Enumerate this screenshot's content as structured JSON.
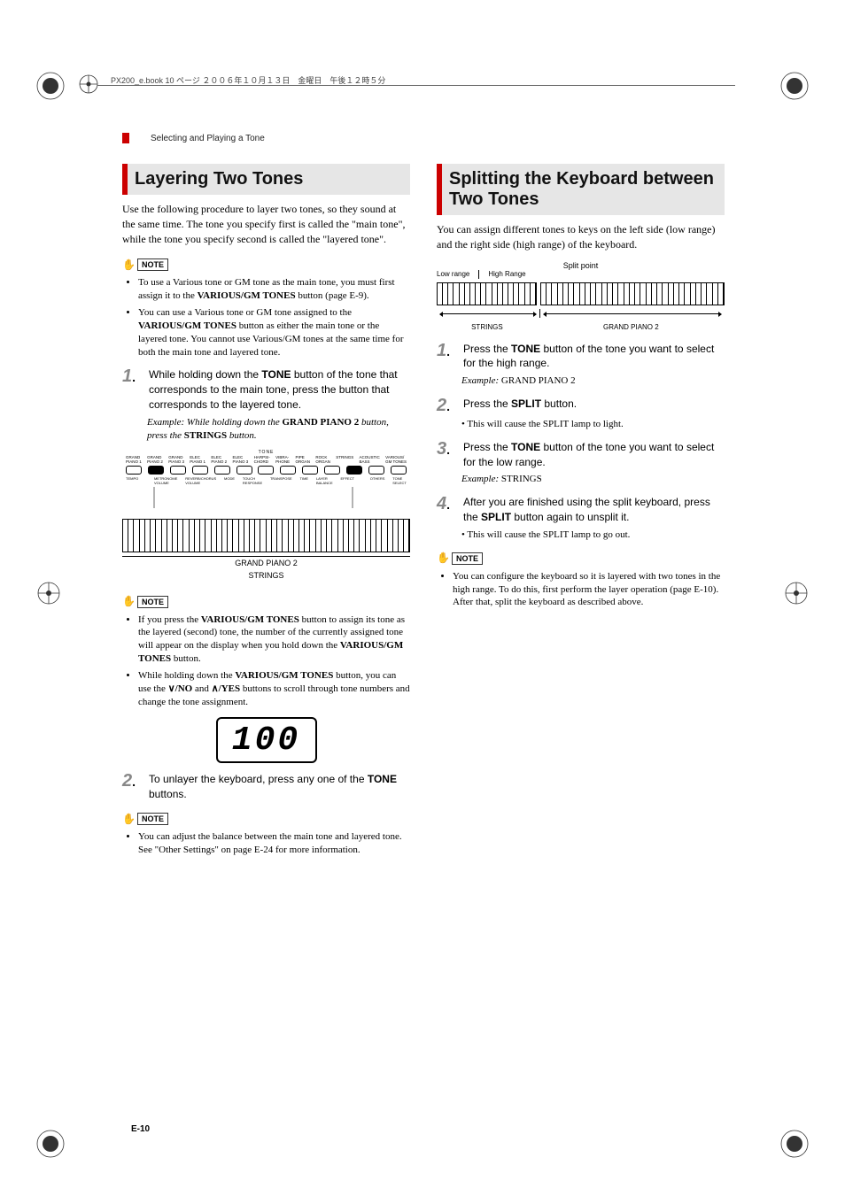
{
  "header_text": "PX200_e.book  10 ページ  ２００６年１０月１３日　金曜日　午後１２時５分",
  "breadcrumb": "Selecting and Playing a Tone",
  "footer_page": "E-10",
  "left": {
    "h2": "Layering Two Tones",
    "intro": "Use the following procedure to layer two tones, so they sound at the same time. The tone you specify first is called the \"main tone\", while the tone you specify second is called the \"layered tone\".",
    "note1_label": "NOTE",
    "note1": [
      "To use a Various tone or GM tone as the main tone, you must first assign it to the VARIOUS/GM TONES button (page E-9).",
      "You can use a Various tone or GM tone assigned to the VARIOUS/GM TONES button as either the main tone or the layered tone. You cannot use Various/GM tones at the same time for both the main tone and layered tone."
    ],
    "step1": "While holding down the TONE button of the tone that corresponds to the main tone, press the button that corresponds to the layered tone.",
    "example1_prefix": "Example:",
    "example1": "While holding down the GRAND PIANO 2 button, press the STRINGS button.",
    "panel": {
      "title": "TONE",
      "top": [
        "GRAND PIANO 1",
        "GRAND PIANO 2",
        "GRAND PIANO 3",
        "ELEC PIANO 1",
        "ELEC PIANO 2",
        "ELEC PIANO 3",
        "HARPSI-CHORD",
        "VIBRA-PHONE",
        "PIPE ORGAN",
        "ROCK ORGAN",
        "STRINGS",
        "ACOUSTIC BASS",
        "VARIOUS/GM TONES"
      ],
      "bot": [
        "TEMPO",
        "",
        "METRONOME VOLUME",
        "REVERB/CHORUS VOLUME",
        "MODE",
        "TOUCH RESPONSE",
        "TRANSPOSE",
        "TIME",
        "LAYER BALANCE",
        "EFFECT",
        "",
        "OTHERS",
        "TONE SELECT"
      ]
    },
    "kbd_caption1": "GRAND PIANO 2",
    "kbd_caption2": "STRINGS",
    "note2_label": "NOTE",
    "note2": [
      "If you press the VARIOUS/GM TONES button to assign its tone as the layered (second) tone, the number of the currently assigned tone will appear on the display when you hold down the VARIOUS/GM TONES button.",
      "While holding down the VARIOUS/GM TONES button, you can use the ∨/NO and ∧/YES buttons to scroll through tone numbers and change the tone assignment."
    ],
    "display_value": "100",
    "step2": "To unlayer the keyboard, press any one of the TONE buttons.",
    "note3_label": "NOTE",
    "note3": [
      "You can adjust the balance between the main tone and layered tone. See \"Other Settings\" on page E-24 for more information."
    ]
  },
  "right": {
    "h2": "Splitting the Keyboard between Two Tones",
    "intro": "You can assign different tones to keys on the left side (low range) and the right side (high range) of the keyboard.",
    "splitfig": {
      "split_point": "Split point",
      "low_range": "Low range",
      "high_range": "High Range",
      "strings": "STRINGS",
      "grand_piano": "GRAND PIANO 2"
    },
    "step1": "Press the TONE button of the tone you want to select for the high range.",
    "example1_prefix": "Example:",
    "example1": "GRAND PIANO 2",
    "step2": "Press the SPLIT button.",
    "step2_sub": "• This will cause the SPLIT lamp to light.",
    "step3": "Press the TONE button of the tone you want to select for the low range.",
    "example3_prefix": "Example:",
    "example3": "STRINGS",
    "step4": "After you are finished using the split keyboard, press the SPLIT button again to unsplit it.",
    "step4_sub": "• This will cause the SPLIT lamp to go out.",
    "note_label": "NOTE",
    "note": [
      "You can configure the keyboard so it is layered with two tones in the high range. To do this, first perform the layer operation (page E-10). After that, split the keyboard as described above."
    ]
  }
}
